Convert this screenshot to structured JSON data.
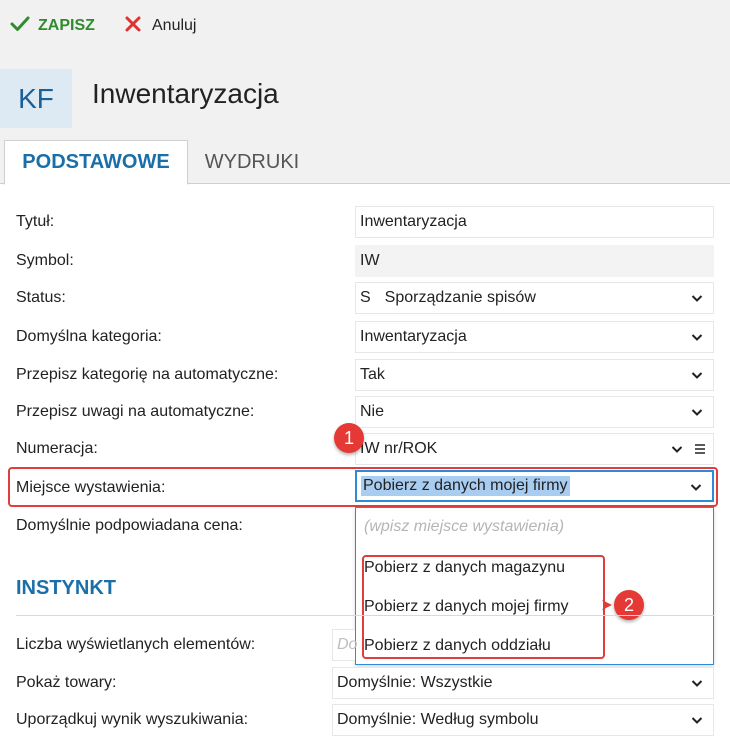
{
  "toolbar": {
    "save_label": "ZAPISZ",
    "cancel_label": "Anuluj"
  },
  "header": {
    "avatar_text": "KF",
    "title": "Inwentaryzacja"
  },
  "tabs": [
    {
      "label": "PODSTAWOWE",
      "active": true
    },
    {
      "label": "WYDRUKI",
      "active": false
    }
  ],
  "form": {
    "title": {
      "label": "Tytuł:",
      "value": "Inwentaryzacja"
    },
    "symbol": {
      "label": "Symbol:",
      "value": "IW"
    },
    "status": {
      "label": "Status:",
      "code": "S",
      "value": "Sporządzanie spisów"
    },
    "default_category": {
      "label": "Domyślna kategoria:",
      "value": "Inwentaryzacja"
    },
    "copy_category": {
      "label": "Przepisz kategorię na automatyczne:",
      "value": "Tak"
    },
    "copy_notes": {
      "label": "Przepisz uwagi na automatyczne:",
      "value": "Nie"
    },
    "numbering": {
      "label": "Numeracja:",
      "value": "IW nr/ROK"
    },
    "place": {
      "label": "Miejsce wystawienia:",
      "value": "Pobierz z danych mojej firmy"
    },
    "default_price": {
      "label": "Domyślnie podpowiadana cena:"
    }
  },
  "dropdown": {
    "placeholder": "(wpisz miejsce wystawienia)",
    "options": [
      "Pobierz z danych magazynu",
      "Pobierz z danych mojej firmy",
      "Pobierz z danych oddziału"
    ]
  },
  "badges": {
    "one": "1",
    "two": "2"
  },
  "instynkt": {
    "title": "INSTYNKT",
    "items_count": {
      "label": "Liczba wyświetlanych elementów:",
      "placeholder": "Do"
    },
    "show_goods": {
      "label": "Pokaż towary:",
      "value": "Domyślnie: Wszystkie"
    },
    "sort_results": {
      "label": "Uporządkuj wynik wyszukiwania:",
      "value": "Domyślnie: Według symbolu"
    }
  },
  "colors": {
    "accent": "#1a6fa8",
    "highlight": "#e03d3d",
    "save_green": "#2e8b2e",
    "selection": "#a9ccf1"
  }
}
